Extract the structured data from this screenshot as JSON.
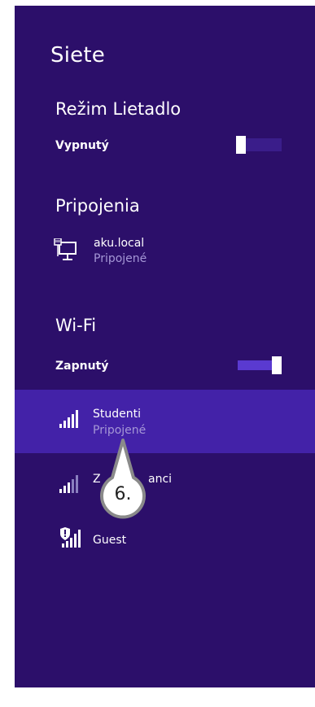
{
  "panel": {
    "title": "Siete"
  },
  "airplane_mode": {
    "heading": "Režim Lietadlo",
    "state_label": "Vypnutý",
    "is_on": false
  },
  "connections": {
    "heading": "Pripojenia",
    "items": [
      {
        "name": "aku.local",
        "status": "Pripojené",
        "icon": "wired-network-icon"
      }
    ]
  },
  "wifi": {
    "heading": "Wi-Fi",
    "state_label": "Zapnutý",
    "is_on": true,
    "networks": [
      {
        "name": "Studenti",
        "status": "Pripojené",
        "icon": "wifi-signal-icon",
        "selected": true
      },
      {
        "name": "Z",
        "name_tail": "anci",
        "status": "",
        "icon": "wifi-signal-icon",
        "selected": false
      },
      {
        "name": "Guest",
        "status": "",
        "icon": "wifi-shield-signal-icon",
        "selected": false
      }
    ]
  },
  "callout": {
    "label": "6."
  },
  "colors": {
    "panel_background": "#2c0f6a",
    "selected_row": "#4322a8",
    "status_text": "#a597d6",
    "callout_fill": "#ffffff",
    "callout_border": "#8a8a8a"
  }
}
